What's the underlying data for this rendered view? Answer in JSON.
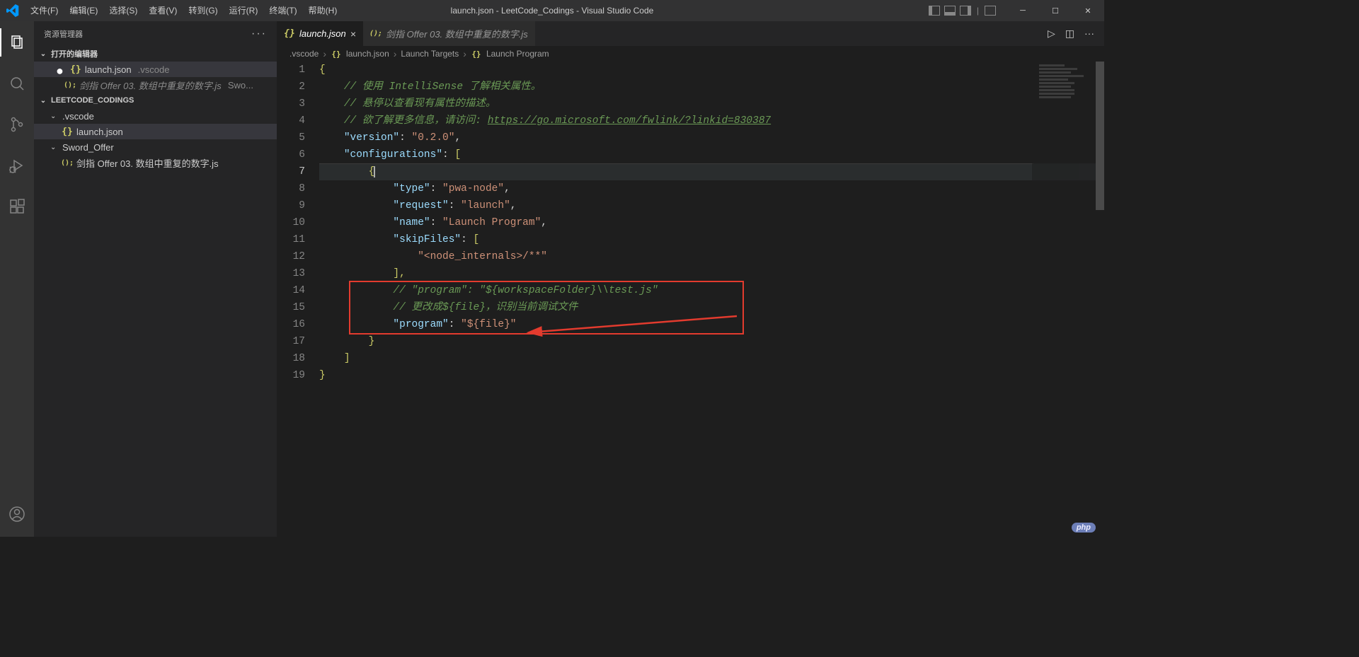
{
  "title": "launch.json - LeetCode_Codings - Visual Studio Code",
  "menu": [
    "文件(F)",
    "编辑(E)",
    "选择(S)",
    "查看(V)",
    "转到(G)",
    "运行(R)",
    "终端(T)",
    "帮助(H)"
  ],
  "sidebar": {
    "title": "资源管理器",
    "sections": {
      "open_editors": "打开的编辑器",
      "workspace": "LEETCODE_CODINGS"
    },
    "open_items": [
      {
        "name": "launch.json",
        "suffix": ".vscode",
        "modified": true,
        "sel": true,
        "icon": "{}"
      },
      {
        "name": "剑指 Offer 03. 数组中重复的数字.js",
        "suffix": "Swo...",
        "icon": "();"
      }
    ],
    "tree": [
      {
        "type": "folder",
        "name": ".vscode"
      },
      {
        "type": "file",
        "name": "launch.json",
        "icon": "{}",
        "sel": true
      },
      {
        "type": "folder",
        "name": "Sword_Offer"
      },
      {
        "type": "file",
        "name": "剑指 Offer 03. 数组中重复的数字.js",
        "icon": "();"
      }
    ]
  },
  "tabs": [
    {
      "label": "launch.json",
      "icon": "{}",
      "active": true,
      "close": "×"
    },
    {
      "label": "剑指 Offer 03. 数组中重复的数字.js",
      "icon": "();",
      "active": false
    }
  ],
  "breadcrumbs": [
    ".vscode",
    "launch.json",
    "Launch Targets",
    "Launch Program"
  ],
  "breadcrumbs_icons": [
    "",
    "{}",
    "",
    "{}"
  ],
  "code": {
    "lines": [
      "1",
      "2",
      "3",
      "4",
      "5",
      "6",
      "7",
      "8",
      "9",
      "10",
      "11",
      "12",
      "13",
      "14",
      "15",
      "16",
      "17",
      "18",
      "19"
    ],
    "l1": "{",
    "l2": "// 使用 IntelliSense 了解相关属性。",
    "l3": "// 悬停以查看现有属性的描述。",
    "l4a": "// 欲了解更多信息，请访问: ",
    "l4b": "https://go.microsoft.com/fwlink/?linkid=830387",
    "l5k": "\"version\"",
    "l5c": ": ",
    "l5v": "\"0.2.0\"",
    "l5e": ",",
    "l6k": "\"configurations\"",
    "l6c": ": ",
    "l6b": "[",
    "l7": "{",
    "l8k": "\"type\"",
    "l8c": ": ",
    "l8v": "\"pwa-node\"",
    "l8e": ",",
    "l9k": "\"request\"",
    "l9c": ": ",
    "l9v": "\"launch\"",
    "l9e": ",",
    "l10k": "\"name\"",
    "l10c": ": ",
    "l10v": "\"Launch Program\"",
    "l10e": ",",
    "l11k": "\"skipFiles\"",
    "l11c": ": ",
    "l11b": "[",
    "l12v": "\"<node_internals>/**\"",
    "l13": "],",
    "l14": "// \"program\": \"${workspaceFolder}\\\\test.js\"",
    "l15": "// 更改成${file}，识别当前调试文件",
    "l16k": "\"program\"",
    "l16c": ": ",
    "l16v": "\"${file}\"",
    "l17": "}",
    "l18": "]",
    "l19": "}"
  },
  "badge": "php"
}
